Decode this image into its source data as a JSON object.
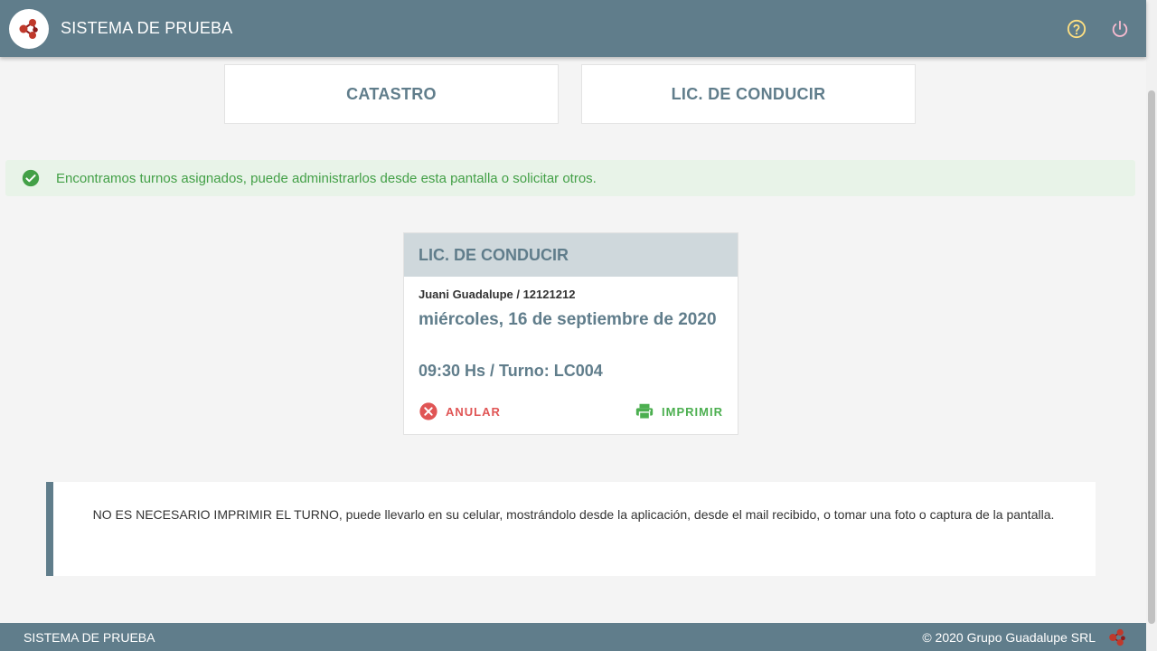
{
  "header": {
    "title": "SISTEMA DE PRUEBA",
    "logo_icon": "molecule-logo-icon",
    "help_icon": "help-circle-icon",
    "power_icon": "power-icon"
  },
  "services": {
    "catastro_label": "CATASTRO",
    "lic_label": "LIC. DE CONDUCIR"
  },
  "alert": {
    "text": "Encontramos turnos asignados, puede administrarlos desde esta pantalla o solicitar otros.",
    "color": "#43a047"
  },
  "turno": {
    "title": "LIC. DE CONDUCIR",
    "person": "Juani Guadalupe / 12121212",
    "date": "miércoles, 16 de septiembre de 2020",
    "hour": "09:30 Hs / Turno: LC004",
    "cancel_label": "ANULAR",
    "print_label": "IMPRIMIR"
  },
  "notice": {
    "text": "NO ES NECESARIO IMPRIMIR EL TURNO, puede llevarlo en su celular, mostrándolo desde la aplicación, desde el mail recibido, o tomar una foto o captura de la pantalla."
  },
  "footer": {
    "left": "SISTEMA DE PRUEBA",
    "right": "© 2020 Grupo Guadalupe SRL"
  },
  "colors": {
    "primary": "#607d8b",
    "danger": "#e05555",
    "success": "#4caf50",
    "logo_red": "#c0392b"
  }
}
